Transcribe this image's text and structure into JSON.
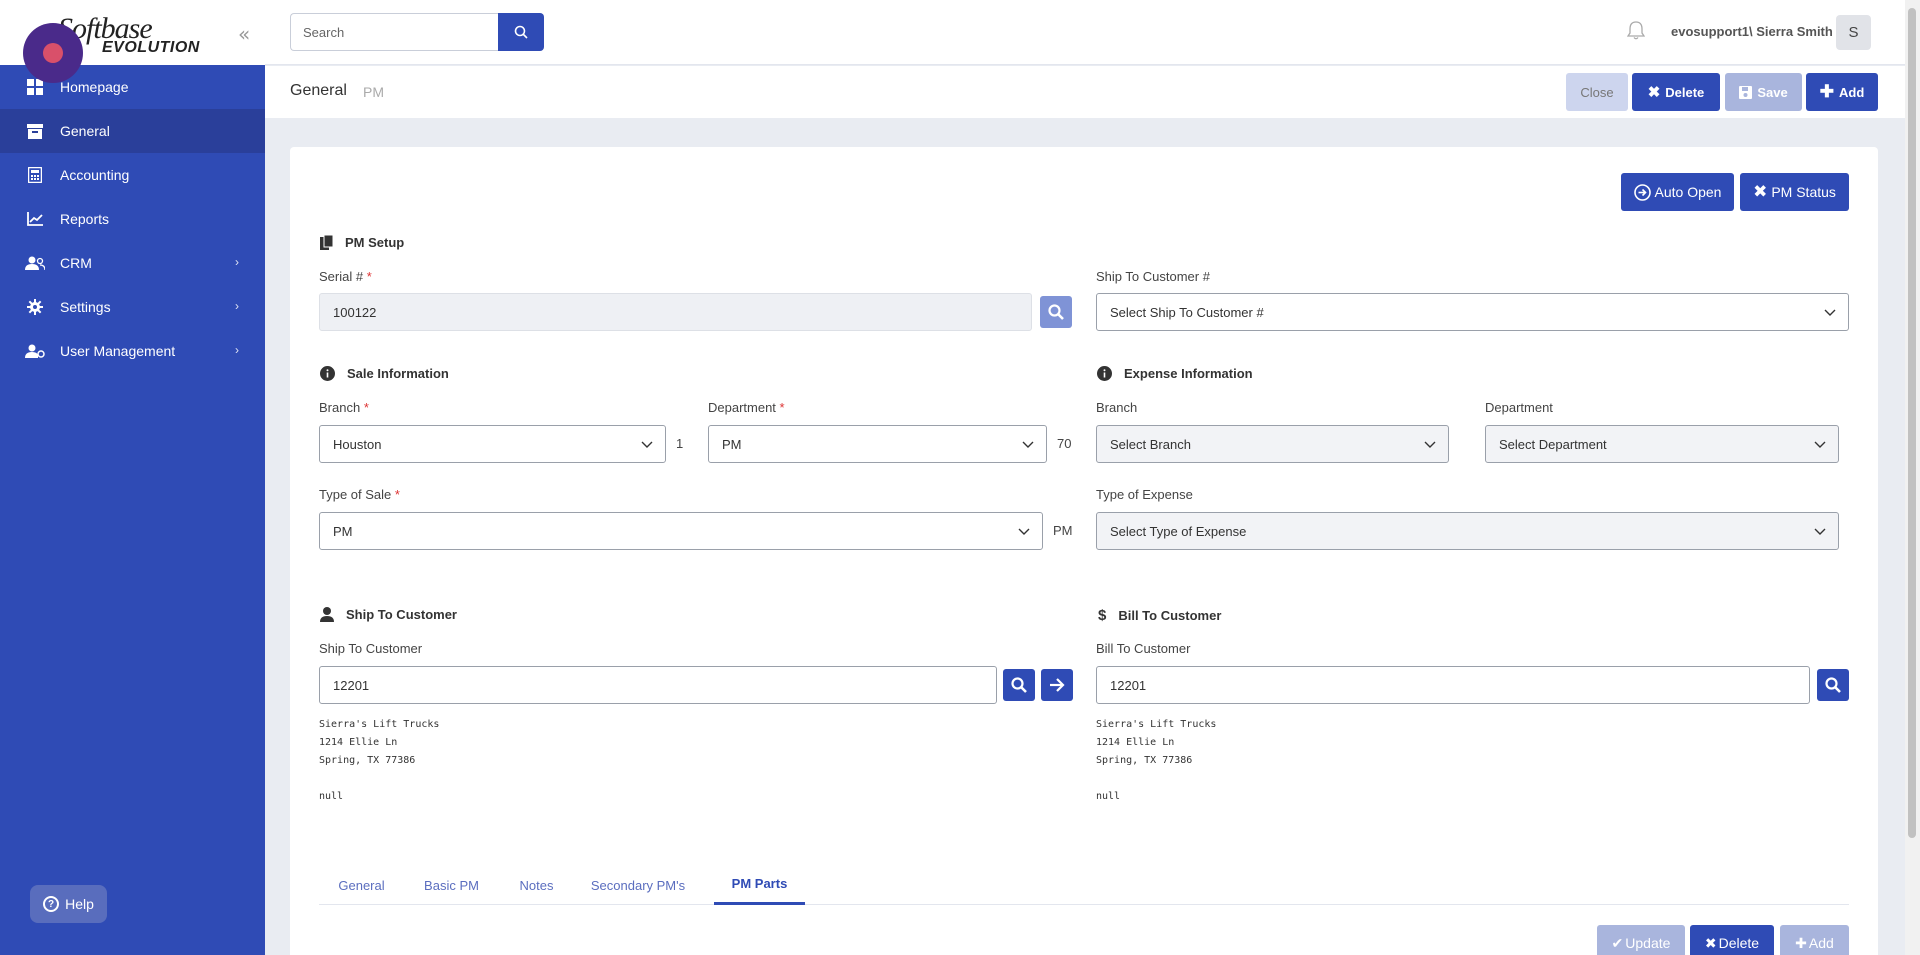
{
  "brand": {
    "line1": "Softbase",
    "line2": "EVOLUTION"
  },
  "colors": {
    "primary": "#2f4bb5",
    "sidebar": "#2f4bb5",
    "sidebar_active": "#2a3f9a",
    "required": "#dd3333"
  },
  "sidebar": {
    "items": [
      {
        "label": "Homepage",
        "icon": "grid-icon"
      },
      {
        "label": "General",
        "icon": "archive-icon"
      },
      {
        "label": "Accounting",
        "icon": "calculator-icon"
      },
      {
        "label": "Reports",
        "icon": "chart-icon"
      },
      {
        "label": "CRM",
        "icon": "users-icon"
      },
      {
        "label": "Settings",
        "icon": "gear-icon"
      },
      {
        "label": "User Management",
        "icon": "user-cog-icon"
      }
    ],
    "help_label": "Help"
  },
  "topbar": {
    "search_placeholder": "Search",
    "user": "evosupport1\\ Sierra Smith",
    "avatar_initial": "S"
  },
  "titlebar": {
    "title": "General",
    "subtitle": "PM",
    "close_label": "Close",
    "delete_label": "Delete",
    "save_label": "Save",
    "add_label": "Add"
  },
  "card": {
    "auto_open_label": "Auto Open",
    "pm_status_label": "PM Status",
    "pm_setup": {
      "heading": "PM Setup",
      "serial_label": "Serial #",
      "serial_value": "100122",
      "ship_to_customer_no_label": "Ship To Customer #",
      "ship_to_customer_no_placeholder": "Select Ship To Customer #"
    },
    "sale_info": {
      "heading": "Sale Information",
      "branch_label": "Branch",
      "branch_value": "Houston",
      "branch_code": "1",
      "department_label": "Department",
      "department_value": "PM",
      "department_code": "70",
      "type_of_sale_label": "Type of Sale",
      "type_of_sale_value": "PM",
      "type_of_sale_code": "PM"
    },
    "expense_info": {
      "heading": "Expense Information",
      "branch_label": "Branch",
      "branch_placeholder": "Select Branch",
      "department_label": "Department",
      "department_placeholder": "Select Department",
      "type_label": "Type of Expense",
      "type_placeholder": "Select Type of Expense"
    },
    "ship_to": {
      "heading": "Ship To Customer",
      "label": "Ship To Customer",
      "value": "12201",
      "address": "Sierra's Lift Trucks\n1214 Ellie Ln\nSpring, TX 77386\n\nnull"
    },
    "bill_to": {
      "heading": "Bill To Customer",
      "label": "Bill To Customer",
      "value": "12201",
      "address": "Sierra's Lift Trucks\n1214 Ellie Ln\nSpring, TX 77386\n\nnull"
    },
    "tabs": [
      "General",
      "Basic PM",
      "Notes",
      "Secondary PM's",
      "PM Parts"
    ],
    "active_tab": "PM Parts",
    "bottom_buttons": {
      "update": "Update",
      "delete": "Delete",
      "add": "Add"
    }
  }
}
